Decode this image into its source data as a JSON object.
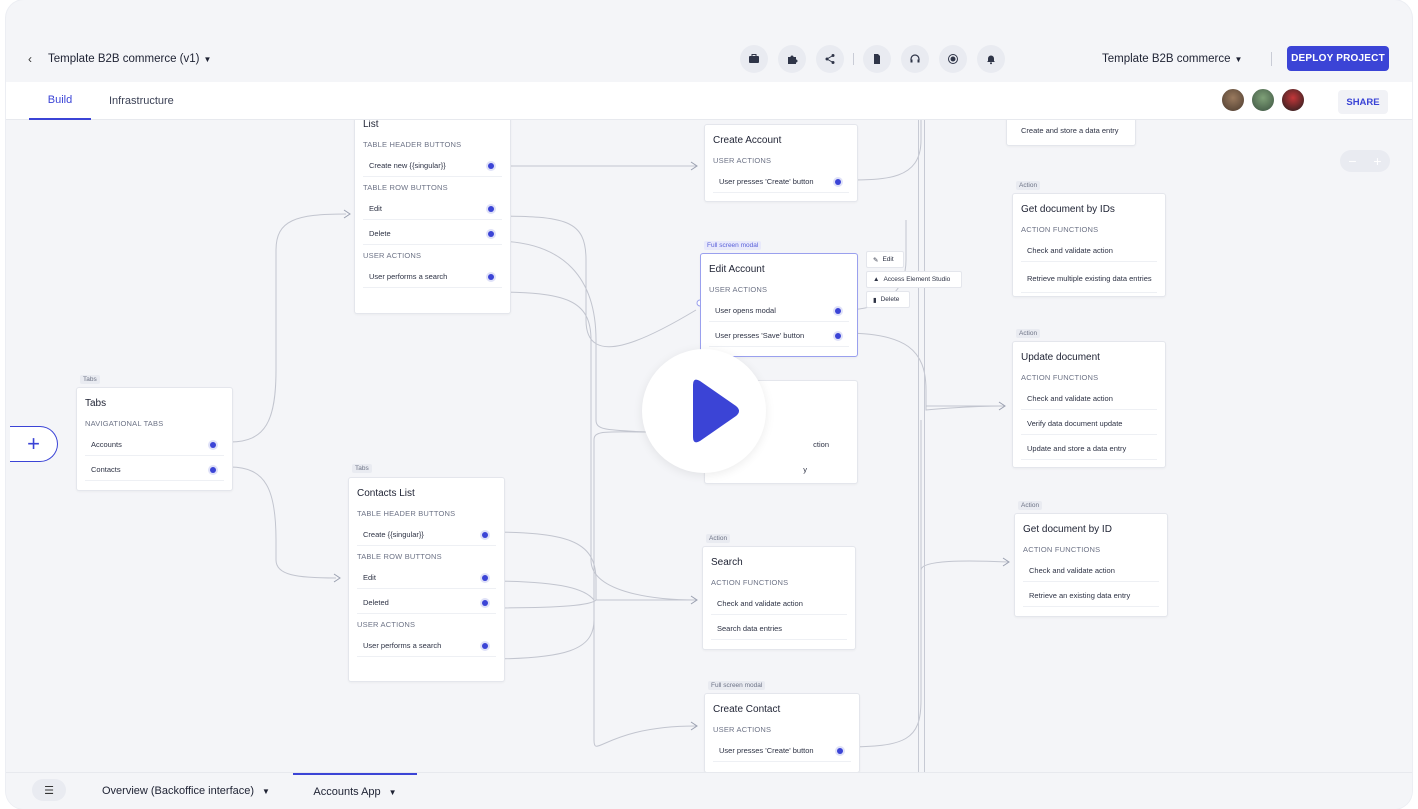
{
  "header": {
    "back_icon": "chevron-left-icon",
    "project_title": "Template B2B commerce (v1)",
    "toolbar_icons": [
      "briefcase-icon",
      "puzzle-icon",
      "share-nodes-icon",
      "document-icon",
      "headset-icon",
      "record-icon",
      "bell-icon"
    ],
    "environment": "Template B2B commerce",
    "deploy_label": "DEPLOY PROJECT",
    "accent": "#3b44d6"
  },
  "tabs": [
    {
      "label": "Build",
      "active": true
    },
    {
      "label": "Infrastructure",
      "active": false
    }
  ],
  "share_label": "SHARE",
  "zoom": {
    "minus": "−",
    "plus": "+"
  },
  "cards": {
    "list": {
      "title": "List",
      "sections": [
        "TABLE HEADER BUTTONS",
        "TABLE ROW BUTTONS",
        "USER ACTIONS"
      ],
      "rows": [
        "Create new {{singular}}",
        "Edit",
        "Delete",
        "User performs a search"
      ]
    },
    "tabs": {
      "tag": "Tabs",
      "title": "Tabs",
      "section": "NAVIGATIONAL TABS",
      "rows": [
        "Accounts",
        "Contacts"
      ]
    },
    "contacts_list": {
      "tag": "Tabs",
      "title": "Contacts List",
      "sections": [
        "TABLE HEADER BUTTONS",
        "TABLE ROW BUTTONS",
        "USER ACTIONS"
      ],
      "rows": [
        "Create {{singular}}",
        "Edit",
        "Deleted",
        "User performs a search"
      ]
    },
    "create_account": {
      "title": "Create Account",
      "section": "USER ACTIONS",
      "rows": [
        "User presses 'Create' button"
      ]
    },
    "edit_account": {
      "tag": "Full screen modal",
      "title": "Edit Account",
      "section": "USER ACTIONS",
      "rows": [
        "User opens modal",
        "User presses 'Save' button"
      ]
    },
    "hidden_card": {
      "rows": [
        "ction",
        "y"
      ]
    },
    "search": {
      "tag": "Action",
      "title": "Search",
      "section": "ACTION FUNCTIONS",
      "rows": [
        "Check and validate action",
        "Search data entries"
      ]
    },
    "create_contact": {
      "tag": "Full screen modal",
      "title": "Create Contact",
      "section": "USER ACTIONS",
      "rows": [
        "User presses 'Create' button"
      ]
    },
    "store_entry": {
      "rows": [
        "Create and store a data entry"
      ]
    },
    "get_docs_ids": {
      "tag": "Action",
      "title": "Get document by IDs",
      "section": "ACTION FUNCTIONS",
      "rows": [
        "Check and validate action",
        "Retrieve multiple existing data entries"
      ]
    },
    "update_doc": {
      "tag": "Action",
      "title": "Update document",
      "section": "ACTION FUNCTIONS",
      "rows": [
        "Check and validate action",
        "Verify data document update",
        "Update and store a data entry"
      ]
    },
    "get_doc_id": {
      "tag": "Action",
      "title": "Get document by ID",
      "section": "ACTION FUNCTIONS",
      "rows": [
        "Check and validate action",
        "Retrieve an existing data entry"
      ]
    }
  },
  "context_menu": [
    {
      "icon": "pencil-icon",
      "label": "Edit"
    },
    {
      "icon": "element-studio-icon",
      "label": "Access Element Studio"
    },
    {
      "icon": "trash-icon",
      "label": "Delete"
    }
  ],
  "bottom": {
    "menu_icon": "hamburger-icon",
    "tabs": [
      {
        "label": "Overview (Backoffice interface)",
        "active": false
      },
      {
        "label": "Accounts App",
        "active": true
      }
    ]
  }
}
